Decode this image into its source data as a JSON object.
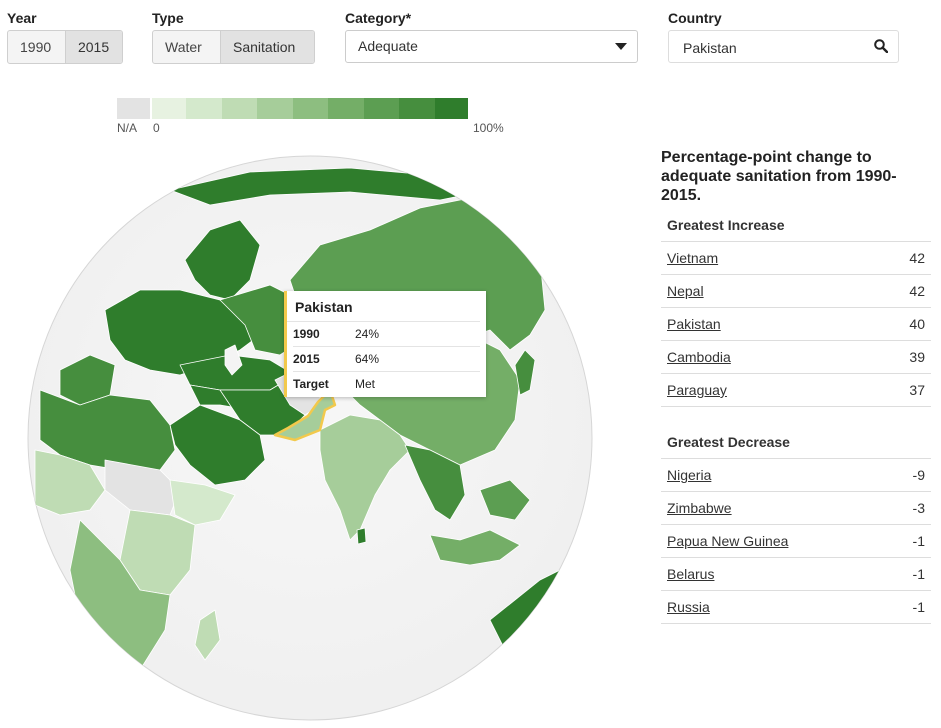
{
  "controls": {
    "year_label": "Year",
    "year_options": [
      "1990",
      "2015"
    ],
    "type_label": "Type",
    "type_options": [
      "Water",
      "Sanitation"
    ],
    "category_label": "Category*",
    "category_value": "Adequate",
    "country_label": "Country",
    "country_value": "Pakistan"
  },
  "legend": {
    "na_label": "N/A",
    "min_label": "0",
    "max_label": "100%",
    "colors": [
      "#e3e3e3",
      "#e7f2e1",
      "#d4e9cc",
      "#bfdcb4",
      "#a6cd9a",
      "#8dbe80",
      "#74ae67",
      "#5c9e52",
      "#468e3e",
      "#2f7d2c"
    ]
  },
  "tooltip": {
    "country": "Pakistan",
    "rows": [
      {
        "key": "1990",
        "value": "24%"
      },
      {
        "key": "2015",
        "value": "64%"
      },
      {
        "key": "Target",
        "value": "Met"
      }
    ]
  },
  "panel": {
    "title": "Percentage-point change to adequate sanitation from 1990-2015.",
    "increase_heading": "Greatest Increase",
    "increase": [
      {
        "country": "Vietnam",
        "value": "42"
      },
      {
        "country": "Nepal",
        "value": "42"
      },
      {
        "country": "Pakistan",
        "value": "40"
      },
      {
        "country": "Cambodia",
        "value": "39"
      },
      {
        "country": "Paraguay",
        "value": "37"
      }
    ],
    "decrease_heading": "Greatest Decrease",
    "decrease": [
      {
        "country": "Nigeria",
        "value": "-9"
      },
      {
        "country": "Zimbabwe",
        "value": "-3"
      },
      {
        "country": "Papua New Guinea",
        "value": "-1"
      },
      {
        "country": "Belarus",
        "value": "-1"
      },
      {
        "country": "Russia",
        "value": "-1"
      }
    ]
  },
  "colors": {
    "highlight_border": "#f2c94c",
    "ocean": "#f4f4f4"
  }
}
